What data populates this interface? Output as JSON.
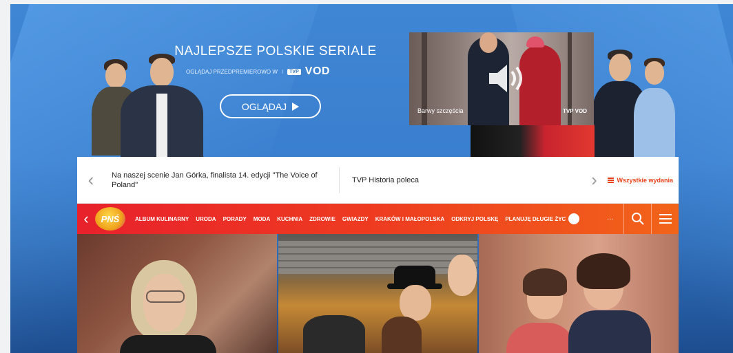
{
  "banner": {
    "title": "NAJLEPSZE POLSKIE SERIALE",
    "subtitle": "OGLĄDAJ PRZEDPREMIEROWO W",
    "separator": "I",
    "tvp_logo": "TVP",
    "vod": "VOD",
    "watch_button": "OGLĄDAJ",
    "video": {
      "caption": "Barwy szczęścia",
      "vod_tag": "TVP VOD",
      "speaker_icon": "speaker-icon"
    }
  },
  "ticker": {
    "item1": "Na naszej scenie Jan Górka, finalista 14. edycji \"The Voice of Poland\"",
    "item2": "TVP Historia poleca",
    "all_editions": "Wszystkie wydania"
  },
  "nav": {
    "logo": "PNŚ",
    "items": [
      "ALBUM KULINARNY",
      "URODA",
      "PORADY",
      "MODA",
      "KUCHNIA",
      "ZDROWIE",
      "GWIAZDY",
      "KRAKÓW I MAŁOPOLSKA",
      "ODKRYJ POLSKĘ",
      "PLANUJĘ DŁUGIE ŻYC"
    ],
    "badge": "f",
    "more": "···"
  },
  "colors": {
    "accent": "#e8431c",
    "nav_start": "#e8212b",
    "nav_end": "#f2641a",
    "banner": "#3a7fcf"
  }
}
